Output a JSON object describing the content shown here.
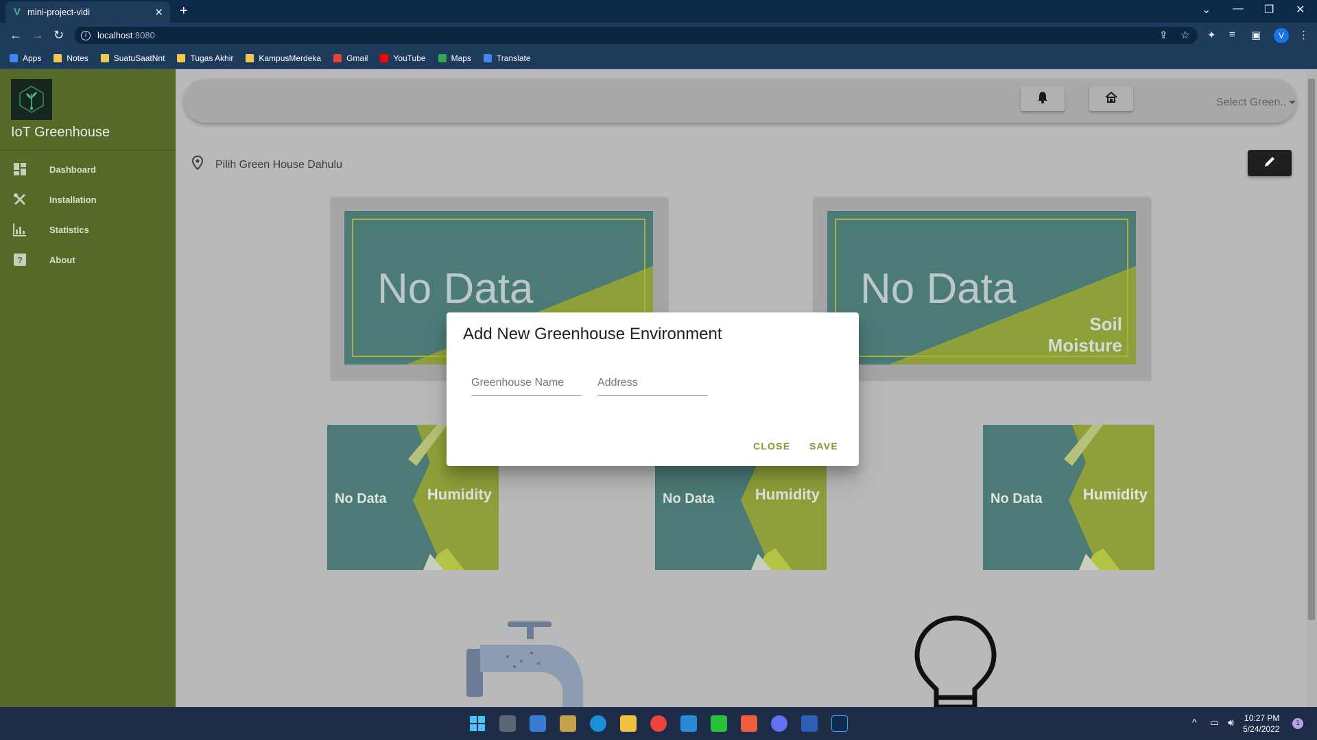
{
  "browser": {
    "tab_title": "mini-project-vidi",
    "url_host": "localhost",
    "url_port": ":8080",
    "bookmarks": [
      {
        "label": "Apps",
        "icon": "apps-grid-icon"
      },
      {
        "label": "Notes",
        "icon": "folder-icon"
      },
      {
        "label": "SuatuSaatNnt",
        "icon": "folder-icon"
      },
      {
        "label": "Tugas Akhir",
        "icon": "folder-icon"
      },
      {
        "label": "KampusMerdeka",
        "icon": "folder-icon"
      },
      {
        "label": "Gmail",
        "icon": "gmail-icon"
      },
      {
        "label": "YouTube",
        "icon": "youtube-icon"
      },
      {
        "label": "Maps",
        "icon": "maps-icon"
      },
      {
        "label": "Translate",
        "icon": "translate-icon"
      }
    ],
    "profile_initial": "V"
  },
  "sidebar": {
    "brand": "IoT Greenhouse",
    "items": [
      {
        "label": "Dashboard",
        "icon": "dashboard-icon"
      },
      {
        "label": "Installation",
        "icon": "tools-icon"
      },
      {
        "label": "Statistics",
        "icon": "bar-chart-icon"
      },
      {
        "label": "About",
        "icon": "help-icon"
      }
    ]
  },
  "header": {
    "select_placeholder": "Select Green..",
    "location_text": "Pilih Green House Dahulu"
  },
  "cards": {
    "large": [
      {
        "value": "No Data",
        "label": "",
        "color_base": "#4c7a76",
        "color_accent": "#8fa03a"
      },
      {
        "value": "No Data",
        "label_line1": "Soil",
        "label_line2": "Moisture",
        "color_base": "#4c7a76",
        "color_accent": "#8fa03a"
      }
    ],
    "small": [
      {
        "value": "No Data",
        "label": "Humidity"
      },
      {
        "value": "No Data",
        "label": "Humidity"
      },
      {
        "value": "No Data",
        "label": "Humidity"
      }
    ]
  },
  "dialog": {
    "title": "Add New Greenhouse Environment",
    "name_placeholder": "Greenhouse Name",
    "address_placeholder": "Address",
    "close_label": "CLOSE",
    "save_label": "SAVE",
    "accent_color": "#7f9a2e"
  },
  "taskbar": {
    "time": "10:27 PM",
    "date": "5/24/2022",
    "notification_count": "1"
  }
}
